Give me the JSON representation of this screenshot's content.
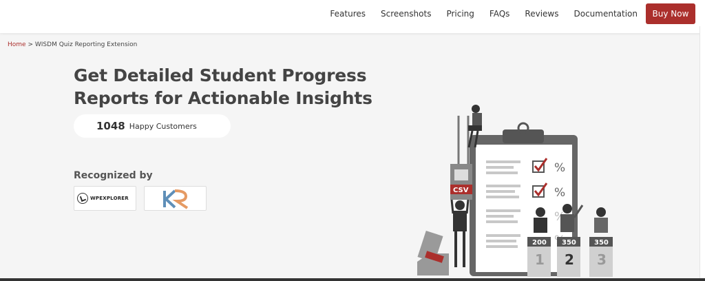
{
  "nav": {
    "items": [
      "Features",
      "Screenshots",
      "Pricing",
      "FAQs",
      "Reviews",
      "Documentation"
    ],
    "buy_label": "Buy Now"
  },
  "breadcrumb": {
    "home": "Home",
    "separator": ">",
    "current": "WISDM Quiz Reporting Extension"
  },
  "hero": {
    "title": "Get Detailed Student Progress Reports for Actionable Insights",
    "customers_count": "1048",
    "customers_label": "Happy Customers",
    "recognized_label": "Recognized by",
    "logos": [
      "WPEXPLORER",
      "KR"
    ]
  },
  "illustration": {
    "csv_label": "CSV",
    "percent": "%",
    "scores": [
      "200",
      "350",
      "350"
    ],
    "ranks": [
      "1",
      "2",
      "3"
    ]
  },
  "colors": {
    "accent": "#ab2f2c",
    "dark": "#444444",
    "background": "#f5f5f5"
  }
}
